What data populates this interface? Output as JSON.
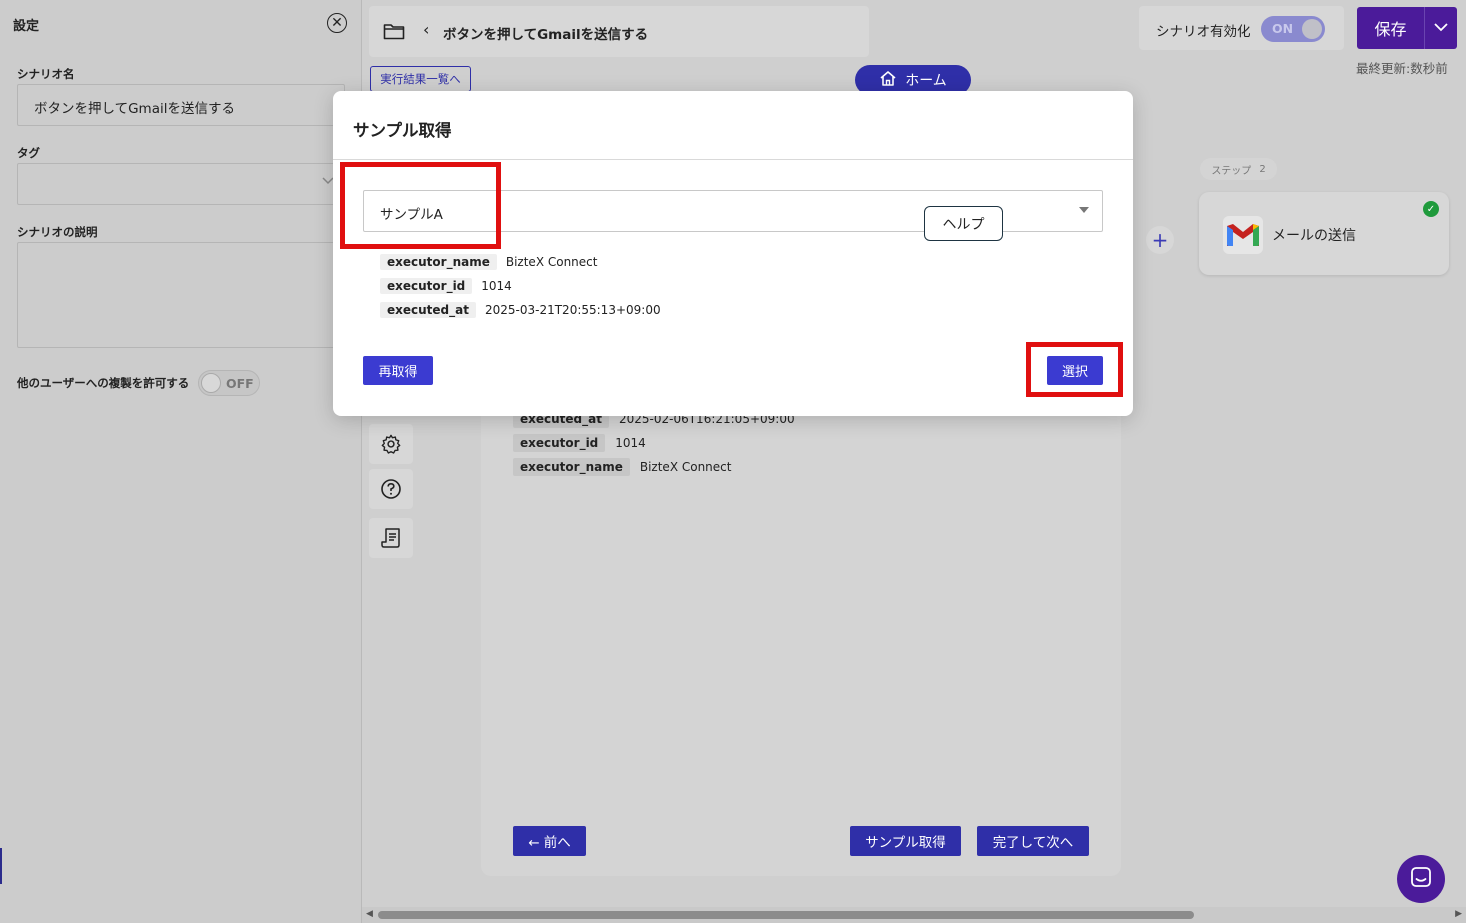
{
  "settings_panel": {
    "title": "設定",
    "scenario_name_label": "シナリオ名",
    "scenario_name_value": "ボタンを押してGmailを送信する",
    "tag_label": "タグ",
    "description_label": "シナリオの説明",
    "copy_permission_label": "他のユーザーへの複製を許可する",
    "copy_toggle_state": "OFF"
  },
  "header": {
    "scenario_title": "ボタンを押してGmailを送信する",
    "results_link": "実行結果一覧へ",
    "home_button": "ホーム",
    "enable_label": "シナリオ有効化",
    "enable_toggle_state": "ON",
    "save_button": "保存",
    "last_updated": "最終更新:数秒前"
  },
  "canvas": {
    "step_badge_label": "ステップ",
    "step_badge_number": "2",
    "step_name": "メールの送信"
  },
  "editor": {
    "rows": [
      {
        "key": "executed_at",
        "value": "2025-02-06T16:21:05+09:00"
      },
      {
        "key": "executor_id",
        "value": "1014"
      },
      {
        "key": "executor_name",
        "value": "BizteX Connect"
      }
    ],
    "prev_button": "← 前へ",
    "sample_get_button": "サンプル取得",
    "finish_next_button": "完了して次へ"
  },
  "modal": {
    "title": "サンプル取得",
    "selected_sample": "サンプルA",
    "help_button": "ヘルプ",
    "rows": [
      {
        "key": "executor_name",
        "value": "BizteX Connect"
      },
      {
        "key": "executor_id",
        "value": "1014"
      },
      {
        "key": "executed_at",
        "value": "2025-03-21T20:55:13+09:00"
      }
    ],
    "reget_button": "再取得",
    "select_button": "選択"
  },
  "colors": {
    "primary": "#3b3bd1",
    "save_purple": "#4b1b9a",
    "highlight_red": "#e00f0f",
    "success_green": "#1f9a3c"
  },
  "icons": [
    "close-icon",
    "folder-icon",
    "chevron-left-icon",
    "home-icon",
    "chevron-down-icon",
    "plus-icon",
    "gmail-icon",
    "check-icon",
    "gear-icon",
    "help-icon",
    "log-icon",
    "chat-icon"
  ]
}
